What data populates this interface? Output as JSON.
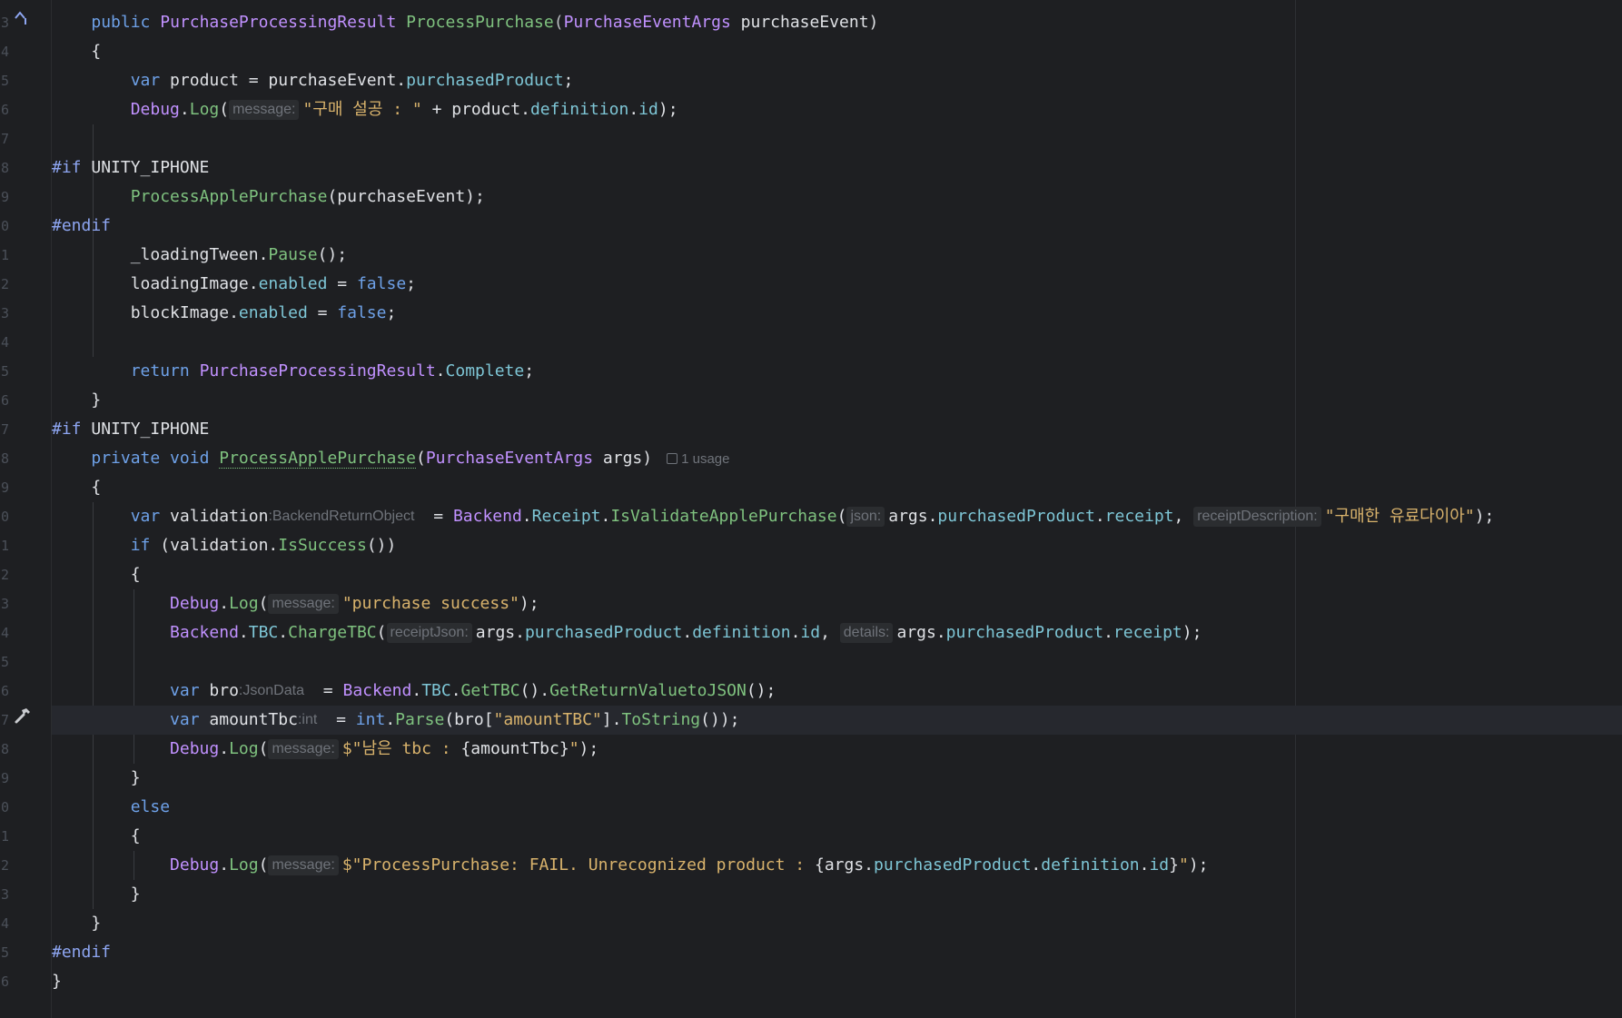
{
  "gutter": {
    "line_numbers": [
      "3",
      "4",
      "5",
      "6",
      "7",
      "8",
      "9",
      "0",
      "1",
      "2",
      "3",
      "4",
      "5",
      "6",
      "7",
      "8",
      "9",
      "0",
      "1",
      "2",
      "3",
      "4",
      "5",
      "6",
      "7",
      "8",
      "9",
      "0",
      "1",
      "2",
      "3",
      "4",
      "5",
      "6"
    ],
    "icons": {
      "override": "override-icon",
      "hammer": "hammer-icon"
    }
  },
  "code": {
    "l1": {
      "public": "public",
      "ret_type": "PurchaseProcessingResult",
      "method": "ProcessPurchase",
      "open": "(",
      "param_type": "PurchaseEventArgs",
      "param": " purchaseEvent)"
    },
    "l2": {
      "text": "{"
    },
    "l3": {
      "var": "var",
      "name": " product = purchaseEvent.",
      "prop": "purchasedProduct",
      "end": ";"
    },
    "l4": {
      "cls": "Debug",
      "dot": ".",
      "method": "Log",
      "open": "(",
      "hint": "message:",
      "str": "\"구매 설공 : \"",
      "rest": " + product.",
      "p1": "definition",
      "dot2": ".",
      "p2": "id",
      "end": ");"
    },
    "l6": {
      "pp": "#if",
      "sym": " UNITY_IPHONE"
    },
    "l7": {
      "method": "ProcessApplePurchase",
      "rest": "(purchaseEvent);"
    },
    "l8": {
      "pp": "#endif"
    },
    "l9": {
      "name": "_loadingTween.",
      "method": "Pause",
      "end": "();"
    },
    "l10": {
      "name": "loadingImage.",
      "prop": "enabled",
      "eq": " = ",
      "val": "false",
      "end": ";"
    },
    "l11": {
      "name": "blockImage.",
      "prop": "enabled",
      "eq": " = ",
      "val": "false",
      "end": ";"
    },
    "l13": {
      "kw": "return",
      "type": " PurchaseProcessingResult",
      "dot": ".",
      "prop": "Complete",
      "end": ";"
    },
    "l14": {
      "text": "}"
    },
    "l15": {
      "pp": "#if",
      "sym": " UNITY_IPHONE"
    },
    "l16": {
      "private": "private",
      "void": " void",
      "method": "ProcessApplePurchase",
      "open": "(",
      "param_type": "PurchaseEventArgs",
      "param": " args)",
      "usage": "1 usage"
    },
    "l17": {
      "text": "{"
    },
    "l18": {
      "var": "var",
      "name": " validation",
      "hint_type": ":BackendReturnObject",
      "eq": " = ",
      "c1": "Backend",
      "dot1": ".",
      "c2": "Receipt",
      "dot2": ".",
      "method": "IsValidateApplePurchase",
      "open": "(",
      "hint1": "json:",
      "a1": "args.",
      "p1": "purchasedProduct",
      "dot3": ".",
      "p2": "receipt",
      "comma": ", ",
      "hint2": "receiptDescription:",
      "str": "\"구매한 유료다이아\"",
      "end": ");"
    },
    "l19": {
      "kw": "if",
      "rest": " (validation.",
      "method": "IsSuccess",
      "end": "())"
    },
    "l20": {
      "text": "{"
    },
    "l21": {
      "cls": "Debug",
      "dot": ".",
      "method": "Log",
      "open": "(",
      "hint": "message:",
      "str": "\"purchase success\"",
      "end": ");"
    },
    "l22": {
      "c1": "Backend",
      "dot1": ".",
      "c2": "TBC",
      "dot2": ".",
      "method": "ChargeTBC",
      "open": "(",
      "hint1": "receiptJson:",
      "a1": "args.",
      "p1": "purchasedProduct",
      "dot3": ".",
      "p2": "definition",
      "dot4": ".",
      "p3": "id",
      "comma": ", ",
      "hint2": "details:",
      "a2": "args.",
      "p4": "purchasedProduct",
      "dot5": ".",
      "p5": "receipt",
      "end": ");"
    },
    "l24": {
      "var": "var",
      "name": " bro",
      "hint_type": ":JsonData",
      "eq": " = ",
      "c1": "Backend",
      "dot1": ".",
      "c2": "TBC",
      "dot2": ".",
      "m1": "GetTBC",
      "mid": "().",
      "m2": "GetReturnValuetoJSON",
      "end": "();"
    },
    "l25": {
      "var": "var",
      "name": " amountTbc",
      "hint_type": ":int",
      "eq": " = ",
      "kw": "int",
      "dot": ".",
      "method": "Parse",
      "open": "(bro[",
      "str": "\"amountTBC\"",
      "mid": "].",
      "m2": "ToString",
      "end": "());"
    },
    "l26": {
      "cls": "Debug",
      "dot": ".",
      "method": "Log",
      "open": "(",
      "hint": "message:",
      "str1": "$\"남은 tbc : ",
      "interp": "{amountTbc}",
      "str2": "\"",
      "end": ");"
    },
    "l27": {
      "text": "}"
    },
    "l28": {
      "kw": "else"
    },
    "l29": {
      "text": "{"
    },
    "l30": {
      "cls": "Debug",
      "dot": ".",
      "method": "Log",
      "open": "(",
      "hint": "message:",
      "str1": "$\"ProcessPurchase: FAIL. Unrecognized product : ",
      "i1": "{args.",
      "p1": "purchasedProduct",
      "dot1": ".",
      "p2": "definition",
      "dot2": ".",
      "p3": "id",
      "i2": "}",
      "str2": "\"",
      "end": ");"
    },
    "l31": {
      "text": "}"
    },
    "l32": {
      "text": "}"
    },
    "l33": {
      "pp": "#endif"
    },
    "l34": {
      "text": "}"
    }
  },
  "colors": {
    "background": "#1e1f22",
    "keyword": "#6ea1e8",
    "preprocessor": "#8ea6f2",
    "type": "#c191ff",
    "method": "#7fc27f",
    "property": "#7ec6d6",
    "string": "#d9b36c"
  }
}
